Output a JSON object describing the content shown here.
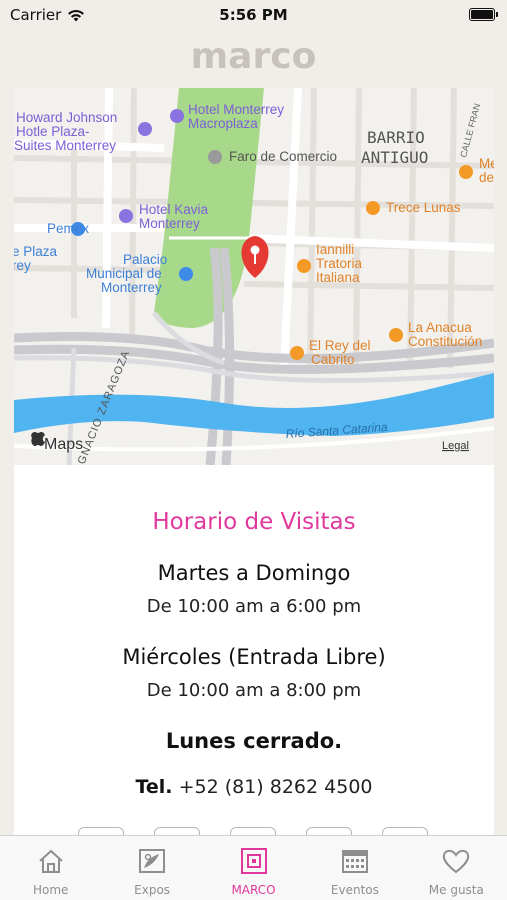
{
  "status_bar": {
    "carrier": "Carrier",
    "time": "5:56 PM"
  },
  "header": {
    "logo": "marco"
  },
  "map": {
    "labels": {
      "howard": [
        "Howard Johnson",
        "Hotle Plaza-",
        "Suites Monterrey"
      ],
      "hotel_monterrey": [
        "Hotel Monterrey",
        "Macroplaza"
      ],
      "barrio": [
        "BARRIO",
        "ANTIGUO"
      ],
      "calle": "CALLE FRAN",
      "faro": "Faro de Comercio",
      "me_de": [
        "Me",
        "de"
      ],
      "trece": "Trece Lunas",
      "pemex": "Pemex",
      "kavia": [
        "Hotel Kavia",
        "Monterrey"
      ],
      "plaza": [
        "e Plaza",
        "rey"
      ],
      "palacio": [
        "Palacio",
        "Municipal de",
        "Monterrey"
      ],
      "iannilli": [
        "Iannilli",
        "Tratoria",
        "Italiana"
      ],
      "anacua": [
        "La Anacua",
        "Constitución"
      ],
      "rey_cabrito": [
        "El Rey del",
        "Cabrito"
      ],
      "zaragoza": "GNACIO ZARAGOZA",
      "rio": "Río Santa Catarina",
      "attribution": "Maps",
      "legal": "Legal"
    }
  },
  "schedule": {
    "title": "Horario de Visitas",
    "blocks": [
      {
        "days": "Martes a Domingo",
        "hours": "De 10:00 am a 6:00 pm"
      },
      {
        "days": "Miércoles (Entrada Libre)",
        "hours": "De 10:00 am a 8:00 pm"
      }
    ],
    "closed": "Lunes cerrado.",
    "tel_label": "Tel.",
    "tel_number": "+52 (81) 8262 4500"
  },
  "tabbar": {
    "items": [
      {
        "label": "Home",
        "icon": "home-icon"
      },
      {
        "label": "Expos",
        "icon": "expos-icon"
      },
      {
        "label": "MARCO",
        "icon": "marco-icon"
      },
      {
        "label": "Eventos",
        "icon": "calendar-icon"
      },
      {
        "label": "Me gusta",
        "icon": "heart-icon"
      }
    ],
    "active": "MARCO"
  },
  "colors": {
    "accent": "#e0389c",
    "park": "#a8d98a",
    "river": "#4fb4f0",
    "poi_orange": "#f39a26",
    "poi_purple": "#8a72e0",
    "poi_blue": "#3d8be6",
    "pin": "#e43a33"
  }
}
